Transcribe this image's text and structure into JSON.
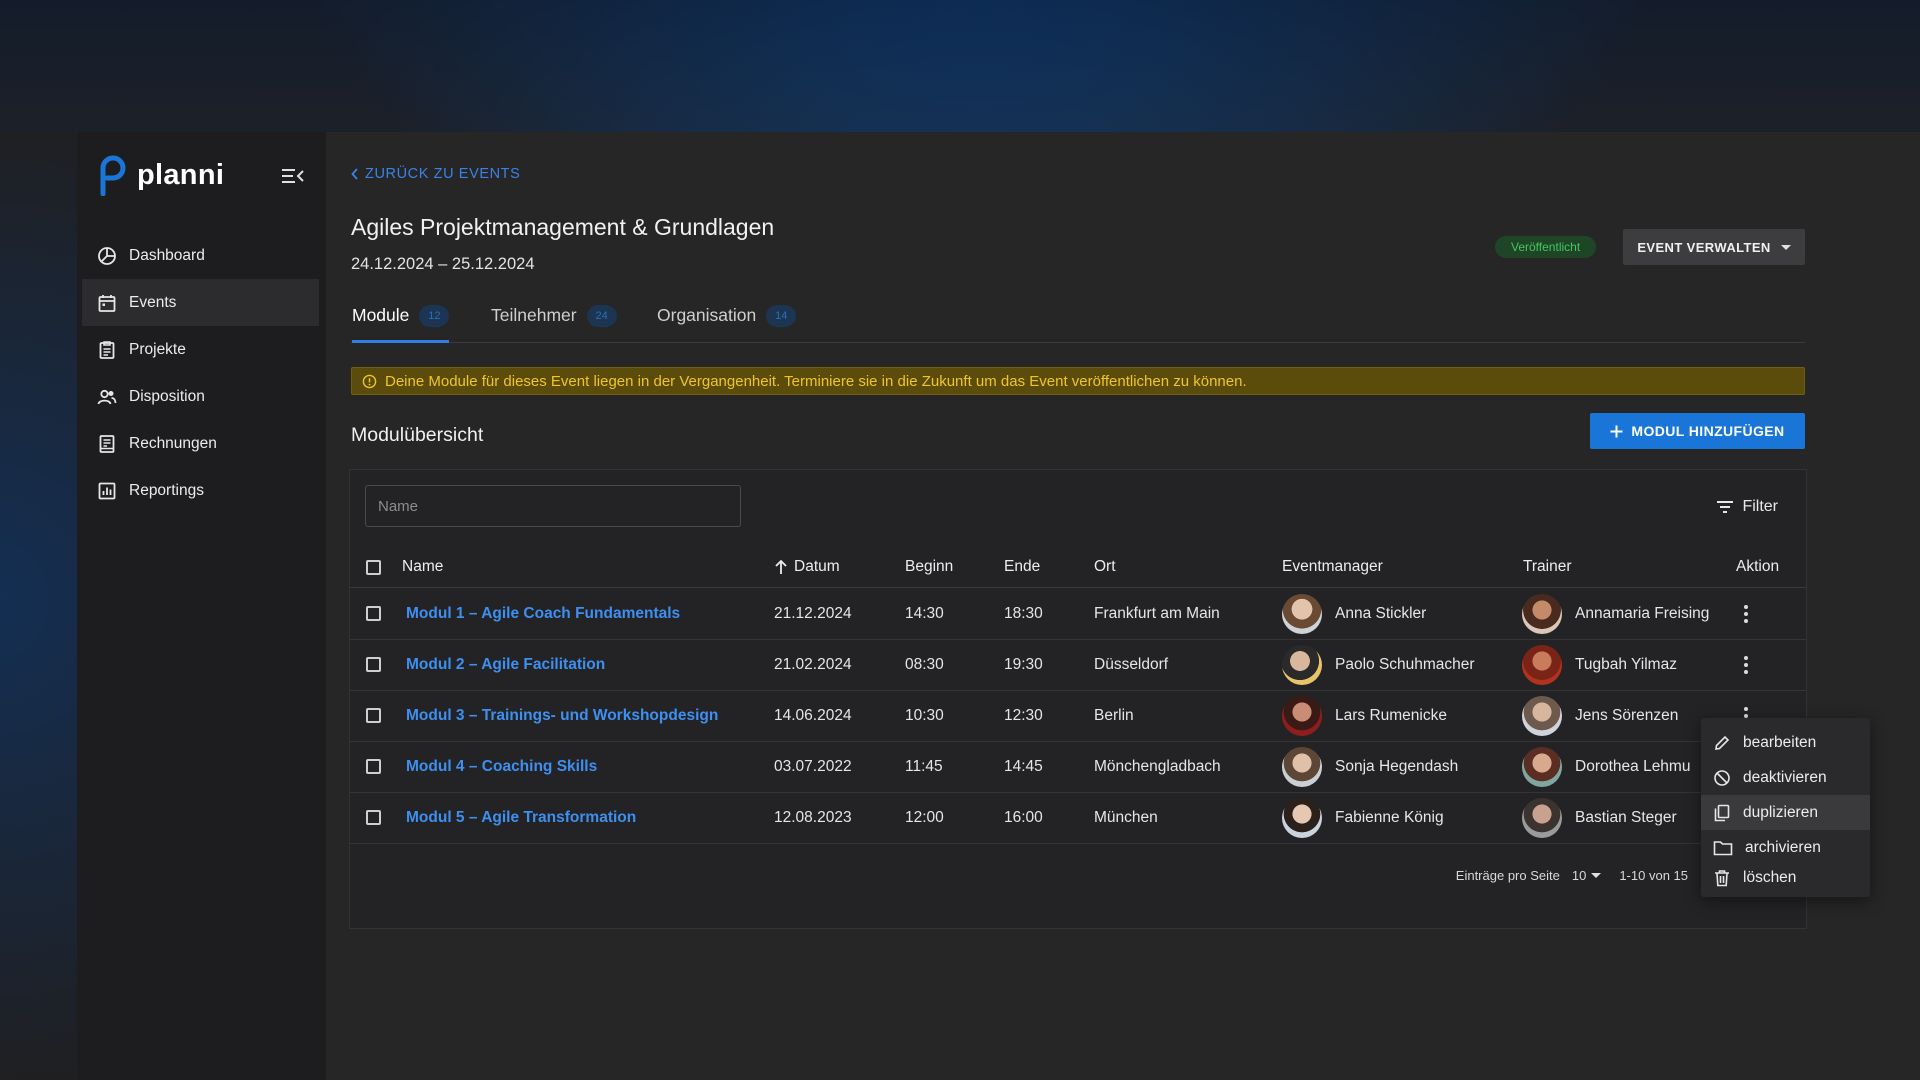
{
  "app": {
    "name": "planni",
    "brand_color": "#1976d8"
  },
  "sidebar": {
    "items": [
      {
        "label": "Dashboard",
        "icon": "dashboard-icon"
      },
      {
        "label": "Events",
        "icon": "calendar-icon",
        "active": true
      },
      {
        "label": "Projekte",
        "icon": "clipboard-icon"
      },
      {
        "label": "Disposition",
        "icon": "people-icon"
      },
      {
        "label": "Rechnungen",
        "icon": "receipt-icon"
      },
      {
        "label": "Reportings",
        "icon": "chart-icon"
      }
    ]
  },
  "header": {
    "back_label": "ZURÜCK ZU EVENTS",
    "title": "Agiles Projektmanagement & Grundlagen",
    "dates": "24.12.2024 – 25.12.2024",
    "status": "Veröffentlicht",
    "status_color": "#45c561",
    "manage_label": "EVENT VERWALTEN"
  },
  "tabs": [
    {
      "label": "Module",
      "count": "12",
      "active": true
    },
    {
      "label": "Teilnehmer",
      "count": "24"
    },
    {
      "label": "Organisation",
      "count": "14"
    }
  ],
  "warning": {
    "text": "Deine Module für dieses Event liegen in der Vergangenheit. Terminiere sie in die Zukunft um das Event veröffentlichen zu können.",
    "color": "#f0c52a"
  },
  "section": {
    "title": "Modulübersicht",
    "add_label": "MODUL HINZUFÜGEN"
  },
  "table": {
    "search_placeholder": "Name",
    "filter_label": "Filter",
    "columns": {
      "name": "Name",
      "datum": "Datum",
      "beginn": "Beginn",
      "ende": "Ende",
      "ort": "Ort",
      "eventmanager": "Eventmanager",
      "trainer": "Trainer",
      "aktion": "Aktion"
    },
    "sort": {
      "column": "Datum",
      "direction": "ascending"
    },
    "rows": [
      {
        "name": "Modul 1 – Agile Coach Fundamentals",
        "datum": "21.12.2024",
        "beginn": "14:30",
        "ende": "18:30",
        "ort": "Frankfurt am Main",
        "eventmanager": "Anna Stickler",
        "trainer": "Annamaria Freising"
      },
      {
        "name": "Modul 2 – Agile Facilitation",
        "datum": "21.02.2024",
        "beginn": "08:30",
        "ende": "19:30",
        "ort": "Düsseldorf",
        "eventmanager": "Paolo Schuhmacher",
        "trainer": "Tugbah Yilmaz"
      },
      {
        "name": "Modul 3 – Trainings- und Workshopdesign",
        "datum": "14.06.2024",
        "beginn": "10:30",
        "ende": "12:30",
        "ort": "Berlin",
        "eventmanager": "Lars Rumenicke",
        "trainer": "Jens Sörenzen"
      },
      {
        "name": "Modul 4 – Coaching Skills",
        "datum": "03.07.2022",
        "beginn": "11:45",
        "ende": "14:45",
        "ort": "Mönchengladbach",
        "eventmanager": "Sonja Hegendash",
        "trainer": "Dorothea Lehmu"
      },
      {
        "name": "Modul 5 – Agile Transformation",
        "datum": "12.08.2023",
        "beginn": "12:00",
        "ende": "16:00",
        "ort": "München",
        "eventmanager": "Fabienne König",
        "trainer": "Bastian Steger"
      }
    ],
    "pagination": {
      "per_page_label": "Einträge pro Seite",
      "per_page_value": "10",
      "range": "1-10 von 15"
    }
  },
  "context_menu": {
    "items": [
      {
        "label": "bearbeiten",
        "icon": "pencil-icon"
      },
      {
        "label": "deaktivieren",
        "icon": "deactivate-icon"
      },
      {
        "label": "duplizieren",
        "icon": "copy-icon",
        "hovered": true
      },
      {
        "label": "archivieren",
        "icon": "folder-icon"
      },
      {
        "label": "löschen",
        "icon": "trash-icon"
      }
    ]
  }
}
